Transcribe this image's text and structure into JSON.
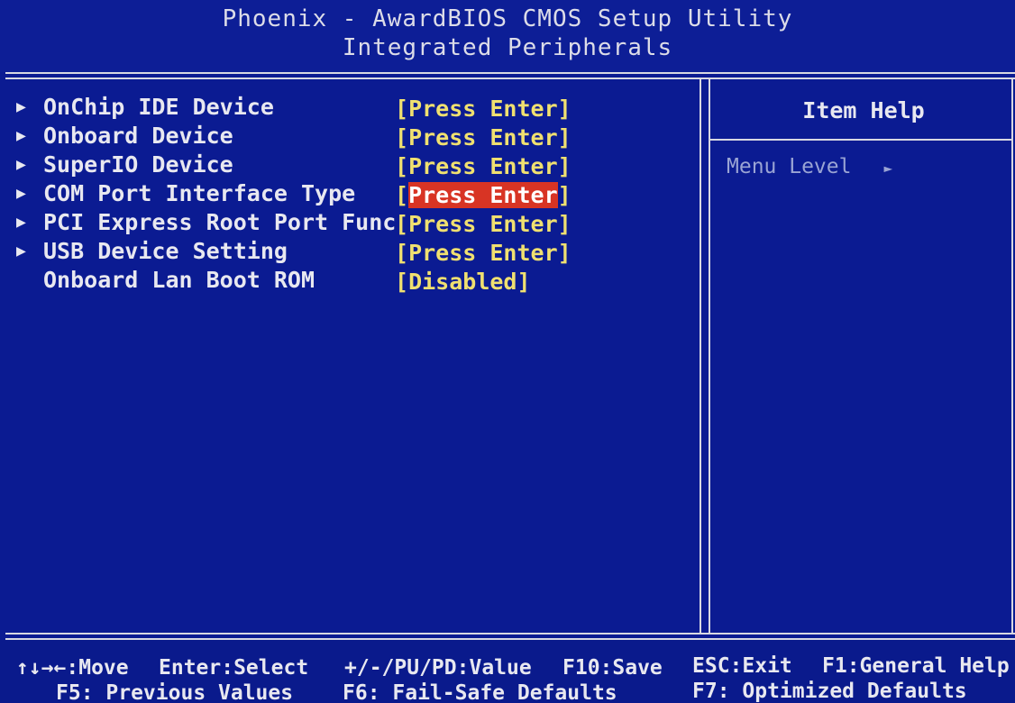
{
  "header": {
    "title": "Phoenix - AwardBIOS CMOS Setup Utility",
    "subtitle": "Integrated Peripherals"
  },
  "menu": {
    "items": [
      {
        "label": "OnChip IDE Device",
        "value_open": "[",
        "value_text": "Press Enter",
        "value_close": "]",
        "has_submenu": true
      },
      {
        "label": "Onboard Device",
        "value_open": "[",
        "value_text": "Press Enter",
        "value_close": "]",
        "has_submenu": true
      },
      {
        "label": "SuperIO Device",
        "value_open": "[",
        "value_text": "Press Enter",
        "value_close": "]",
        "has_submenu": true
      },
      {
        "label": "COM Port Interface Type",
        "value_open": "[",
        "value_text": "Press Enter",
        "value_close": "]",
        "has_submenu": true,
        "selected": true
      },
      {
        "label": "PCI Express Root Port Func",
        "value_open": "[",
        "value_text": "Press Enter",
        "value_close": "]",
        "has_submenu": true
      },
      {
        "label": "USB Device Setting",
        "value_open": "[",
        "value_text": "Press Enter",
        "value_close": "]",
        "has_submenu": true
      },
      {
        "label": "Onboard Lan Boot ROM",
        "value_open": "[",
        "value_text": "Disabled",
        "value_close": "]",
        "has_submenu": false
      }
    ],
    "submenu_arrow_icon": "triangle-right-icon"
  },
  "help": {
    "title": "Item Help",
    "menu_level_label": "Menu Level",
    "menu_level_arrow": "►"
  },
  "footer": {
    "move": "↑↓→←:Move",
    "select": "Enter:Select",
    "value": "+/-/PU/PD:Value",
    "save": "F10:Save",
    "exit": "ESC:Exit",
    "general_help": "F1:General Help",
    "previous_values": "F5: Previous Values",
    "failsafe": "F6: Fail-Safe Defaults",
    "optimized": "F7: Optimized Defaults"
  },
  "colors": {
    "background": "#0b1b92",
    "label_text": "#e8e8f0",
    "value_text": "#f0e070",
    "selection_highlight": "#d83424",
    "help_text": "#9aa4d4"
  }
}
